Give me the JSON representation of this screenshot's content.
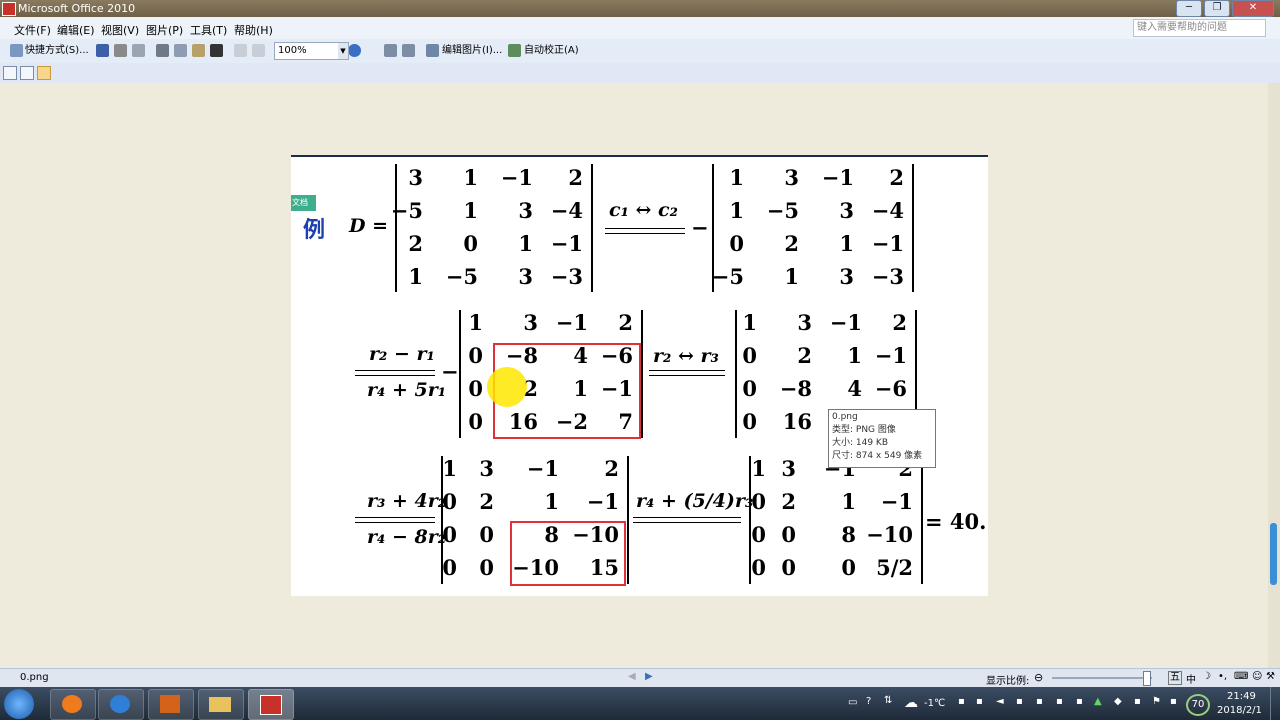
{
  "window": {
    "title": "Microsoft Office 2010",
    "controls": [
      "─",
      "❐",
      "✕"
    ]
  },
  "menu": [
    "文件(F)",
    "编辑(E)",
    "视图(V)",
    "图片(P)",
    "工具(T)",
    "帮助(H)"
  ],
  "help_placeholder": "键入需要帮助的问题",
  "toolbar": {
    "shortcut": "快捷方式(S)...",
    "zoom": "100%",
    "edit_picture": "编辑图片(I)...",
    "auto_correct": "自动校正(A)"
  },
  "image": {
    "badge": "文档",
    "example_label": "例",
    "d_eq": "D =",
    "op_c1c2": "c₁ ↔ c₂",
    "op_r2r1": "r₂ − r₁",
    "op_r4r1": "r₄ + 5r₁",
    "op_r2r3": "r₂ ↔ r₃",
    "op_r3r2": "r₃ + 4r₂",
    "op_r4r2": "r₄ − 8r₂",
    "op_r4r3": "r₄ + (5/4)r₃",
    "minus": "−",
    "result": "= 40.",
    "m1": [
      [
        "3",
        "1",
        "−1",
        "2"
      ],
      [
        "−5",
        "1",
        "3",
        "−4"
      ],
      [
        "2",
        "0",
        "1",
        "−1"
      ],
      [
        "1",
        "−5",
        "3",
        "−3"
      ]
    ],
    "m2": [
      [
        "1",
        "3",
        "−1",
        "2"
      ],
      [
        "1",
        "−5",
        "3",
        "−4"
      ],
      [
        "0",
        "2",
        "1",
        "−1"
      ],
      [
        "−5",
        "1",
        "3",
        "−3"
      ]
    ],
    "m3": [
      [
        "1",
        "3",
        "−1",
        "2"
      ],
      [
        "0",
        "−8",
        "4",
        "−6"
      ],
      [
        "0",
        "2",
        "1",
        "−1"
      ],
      [
        "0",
        "16",
        "−2",
        "7"
      ]
    ],
    "m4": [
      [
        "1",
        "3",
        "−1",
        "2"
      ],
      [
        "0",
        "2",
        "1",
        "−1"
      ],
      [
        "0",
        "−8",
        "4",
        "−6"
      ],
      [
        "0",
        "16",
        "",
        "−"
      ]
    ],
    "m5": [
      [
        "1",
        "3",
        "−1",
        "2"
      ],
      [
        "0",
        "2",
        "1",
        "−1"
      ],
      [
        "0",
        "0",
        "8",
        "−10"
      ],
      [
        "0",
        "0",
        "−10",
        "15"
      ]
    ],
    "m6": [
      [
        "1",
        "3",
        "−1",
        "2"
      ],
      [
        "0",
        "2",
        "1",
        "−1"
      ],
      [
        "0",
        "0",
        "8",
        "−10"
      ],
      [
        "0",
        "0",
        "0",
        "5/2"
      ]
    ]
  },
  "tooltip": {
    "name": "0.png",
    "type": "类型: PNG 图像",
    "size": "大小: 149 KB",
    "dims": "尺寸: 874 x 549 像素"
  },
  "status": {
    "filename": "0.png",
    "zoom_label": "显示比例:",
    "ime": [
      "五",
      "中"
    ]
  },
  "tray": {
    "temp": "-1℃",
    "number": "70",
    "time": "21:49",
    "date": "2018/2/1"
  },
  "colors": {
    "accent": "#3a8fd6",
    "redbox": "#e0303a"
  }
}
